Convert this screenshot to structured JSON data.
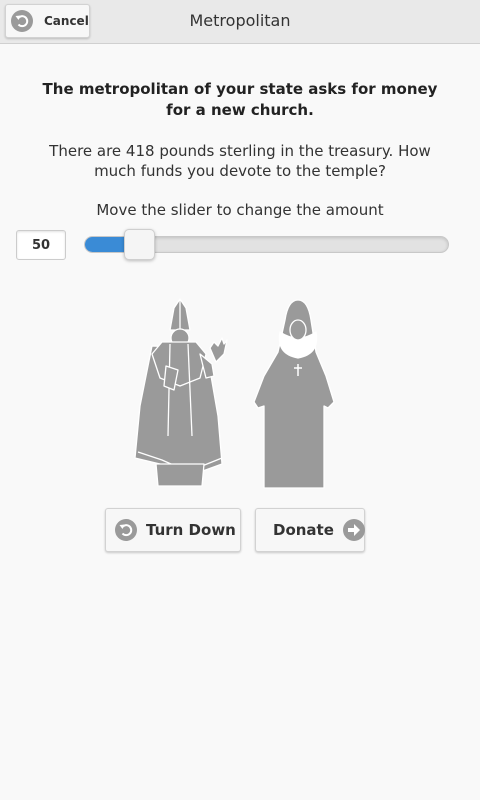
{
  "header": {
    "title": "Metropolitan",
    "cancel_label": "Cancel",
    "cancel_icon": "undo-arrow-icon"
  },
  "question": "The metropolitan of your state asks for money for a new church.",
  "info": "There are 418 pounds sterling in the treasury. How much funds you devote to the temple?",
  "slider": {
    "label": "Move the slider to change the amount",
    "value": "50",
    "min": 0,
    "max": 418,
    "fill_color": "#3a8bd6"
  },
  "illustration": {
    "figures": [
      "pope-figure",
      "nun-figure"
    ],
    "color": "#9a9a9a"
  },
  "actions": {
    "turn_down_label": "Turn Down",
    "turn_down_icon": "undo-arrow-icon",
    "donate_label": "Donate",
    "donate_icon": "arrow-right-icon"
  }
}
